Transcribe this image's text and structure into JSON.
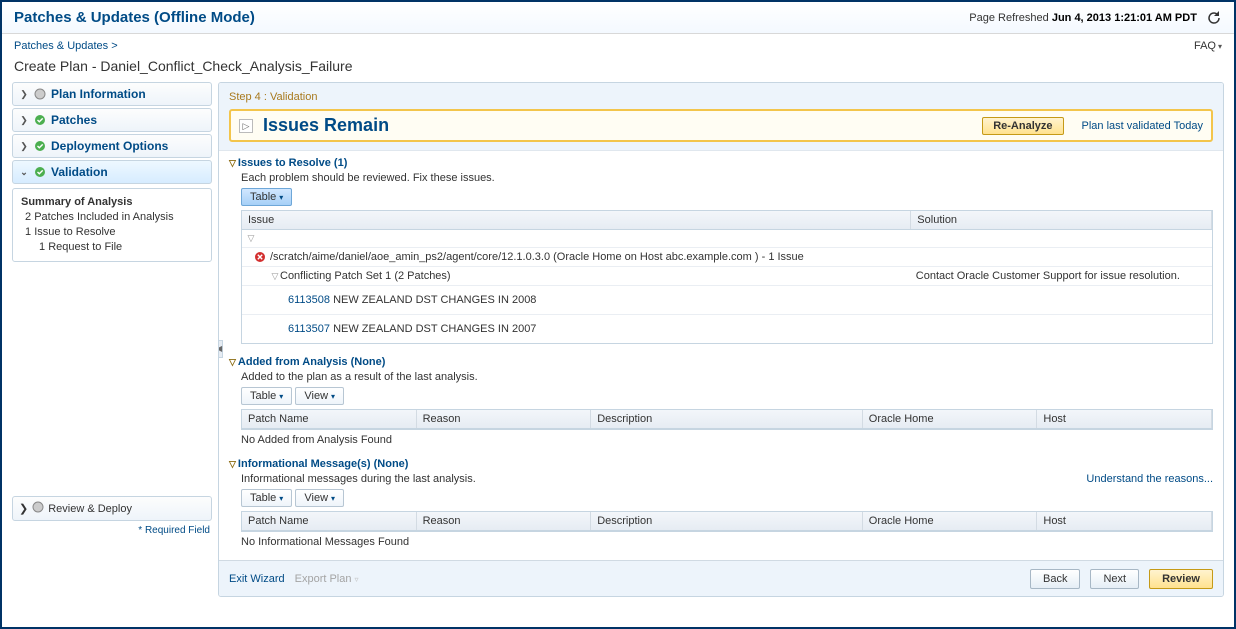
{
  "header": {
    "title": "Patches & Updates (Offline Mode)",
    "refreshed_prefix": "Page Refreshed",
    "refreshed_time": "Jun 4, 2013 1:21:01 AM PDT"
  },
  "breadcrumb": {
    "item": "Patches & Updates",
    "sep": ">"
  },
  "faq": "FAQ",
  "plan_title": "Create Plan - Daniel_Conflict_Check_Analysis_Failure",
  "sidebar": {
    "items": [
      {
        "label": "Plan Information",
        "state": "idle"
      },
      {
        "label": "Patches",
        "state": "ok"
      },
      {
        "label": "Deployment Options",
        "state": "ok"
      },
      {
        "label": "Validation",
        "state": "ok"
      }
    ],
    "summary": {
      "title": "Summary of Analysis",
      "lines": [
        {
          "n": "2",
          "t": "Patches Included in Analysis"
        },
        {
          "n": "1",
          "t": "Issue to Resolve"
        },
        {
          "n": "1",
          "t": "Request to File",
          "sub": true
        }
      ]
    },
    "review": "Review & Deploy",
    "required": "* Required Field"
  },
  "content": {
    "step_label": "Step 4 : Validation",
    "issues_title": "Issues Remain",
    "reanalyze": "Re-Analyze",
    "validated": "Plan last validated Today",
    "issues_section": {
      "heading": "Issues to Resolve (1)",
      "sub": "Each problem should be reviewed. Fix these issues.",
      "table_btn": "Table",
      "columns": {
        "c1": "Issue",
        "c2": "Solution"
      },
      "row_home_path_a": "/scratch/aime/daniel/aoe_amin_ps2/agent/core/12.1.0.3.0 (Oracle Home on Host ",
      "row_home_host": "abc.example.com",
      "row_home_path_b": " ) - 1 Issue",
      "row_set": "Conflicting Patch Set 1 (2 Patches)",
      "row_set_solution": "Contact Oracle Customer Support for issue resolution.",
      "patches": [
        {
          "id": "6113508",
          "desc": "NEW ZEALAND DST CHANGES IN 2008"
        },
        {
          "id": "6113507",
          "desc": "NEW ZEALAND DST CHANGES IN 2007"
        }
      ]
    },
    "added_section": {
      "heading": "Added from Analysis (None)",
      "sub": "Added to the plan as a result of the last analysis.",
      "table_btn": "Table",
      "view_btn": "View",
      "columns": {
        "c1": "Patch Name",
        "c2": "Reason",
        "c3": "Description",
        "c4": "Oracle Home",
        "c5": "Host"
      },
      "empty": "No Added from Analysis Found"
    },
    "info_section": {
      "heading": "Informational Message(s) (None)",
      "sub": "Informational messages during the last analysis.",
      "understand": "Understand the reasons...",
      "table_btn": "Table",
      "view_btn": "View",
      "columns": {
        "c1": "Patch Name",
        "c2": "Reason",
        "c3": "Description",
        "c4": "Oracle Home",
        "c5": "Host"
      },
      "empty": "No Informational Messages Found"
    }
  },
  "footer": {
    "exit": "Exit Wizard",
    "export": "Export Plan",
    "back": "Back",
    "next": "Next",
    "review": "Review"
  }
}
